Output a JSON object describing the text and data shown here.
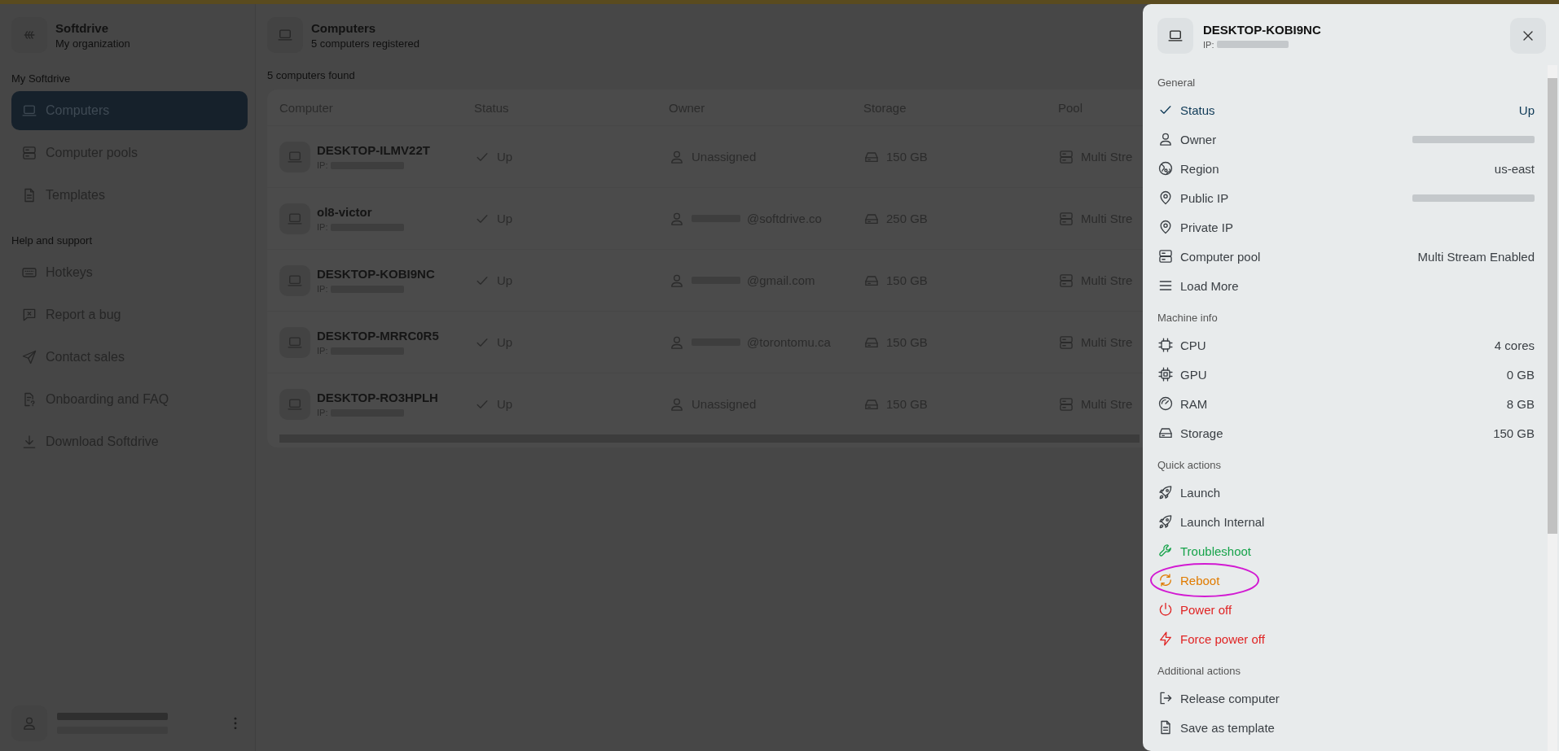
{
  "sidebar": {
    "brand": {
      "name": "Softdrive",
      "subtitle": "My organization"
    },
    "sections": [
      {
        "title": "My Softdrive",
        "items": [
          {
            "label": "Computers",
            "selected": true
          },
          {
            "label": "Computer pools",
            "selected": false
          },
          {
            "label": "Templates",
            "selected": false
          }
        ]
      },
      {
        "title": "Help and support",
        "items": [
          {
            "label": "Hotkeys",
            "selected": false
          },
          {
            "label": "Report a bug",
            "selected": false
          },
          {
            "label": "Contact sales",
            "selected": false
          },
          {
            "label": "Onboarding and FAQ",
            "selected": false
          },
          {
            "label": "Download Softdrive",
            "selected": false
          }
        ]
      }
    ]
  },
  "header": {
    "title": "Computers",
    "subtitle": "5 computers registered"
  },
  "result_count": "5 computers found",
  "table": {
    "columns": [
      "Computer",
      "Status",
      "Owner",
      "Storage",
      "Pool"
    ],
    "rows": [
      {
        "name": "DESKTOP-ILMV22T",
        "ip_label": "IP:",
        "status": "Up",
        "owner": "Unassigned",
        "owner_blurred": false,
        "storage": "150 GB",
        "pool": "Multi Stre"
      },
      {
        "name": "ol8-victor",
        "ip_label": "IP:",
        "status": "Up",
        "owner": "@softdrive.co",
        "owner_blurred": true,
        "storage": "250 GB",
        "pool": "Multi Stre"
      },
      {
        "name": "DESKTOP-KOBI9NC",
        "ip_label": "IP:",
        "status": "Up",
        "owner": "@gmail.com",
        "owner_blurred": true,
        "storage": "150 GB",
        "pool": "Multi Stre"
      },
      {
        "name": "DESKTOP-MRRC0R5",
        "ip_label": "IP:",
        "status": "Up",
        "owner": "@torontomu.ca",
        "owner_blurred": true,
        "storage": "150 GB",
        "pool": "Multi Stre"
      },
      {
        "name": "DESKTOP-RO3HPLH",
        "ip_label": "IP:",
        "status": "Up",
        "owner": "Unassigned",
        "owner_blurred": false,
        "storage": "150 GB",
        "pool": "Multi Stre"
      }
    ]
  },
  "panel": {
    "title": "DESKTOP-KOBI9NC",
    "ip_label": "IP:",
    "sections": [
      {
        "title": "General",
        "rows": [
          {
            "kind": "info",
            "label": "Status",
            "value": "Up",
            "highlight": true,
            "value_blurred": false
          },
          {
            "kind": "info",
            "label": "Owner",
            "value_blurred": true,
            "highlight": false
          },
          {
            "kind": "info",
            "label": "Region",
            "value": "us-east",
            "highlight": false,
            "value_blurred": false
          },
          {
            "kind": "info",
            "label": "Public IP",
            "value_blurred": true,
            "highlight": false
          },
          {
            "kind": "info",
            "label": "Private IP",
            "highlight": false,
            "value_blurred": false
          },
          {
            "kind": "info",
            "label": "Computer pool",
            "value": "Multi Stream Enabled",
            "highlight": false,
            "value_blurred": false
          },
          {
            "kind": "action",
            "label": "Load More",
            "color": "#3a3f44",
            "annotated": false
          }
        ]
      },
      {
        "title": "Machine info",
        "rows": [
          {
            "kind": "info",
            "label": "CPU",
            "value": "4 cores",
            "highlight": false,
            "value_blurred": false
          },
          {
            "kind": "info",
            "label": "GPU",
            "value": "0 GB",
            "highlight": false,
            "value_blurred": false
          },
          {
            "kind": "info",
            "label": "RAM",
            "value": "8 GB",
            "highlight": false,
            "value_blurred": false
          },
          {
            "kind": "info",
            "label": "Storage",
            "value": "150 GB",
            "highlight": false,
            "value_blurred": false
          }
        ]
      },
      {
        "title": "Quick actions",
        "rows": [
          {
            "kind": "action",
            "label": "Launch",
            "color": "#3a3f44",
            "annotated": false
          },
          {
            "kind": "action",
            "label": "Launch Internal",
            "color": "#3a3f44",
            "annotated": false
          },
          {
            "kind": "action",
            "label": "Troubleshoot",
            "color": "#16a34a",
            "annotated": false
          },
          {
            "kind": "action",
            "label": "Reboot",
            "color": "#e07b00",
            "annotated": true
          },
          {
            "kind": "action",
            "label": "Power off",
            "color": "#e02424",
            "annotated": false
          },
          {
            "kind": "action",
            "label": "Force power off",
            "color": "#e02424",
            "annotated": false
          }
        ]
      },
      {
        "title": "Additional actions",
        "rows": [
          {
            "kind": "action",
            "label": "Release computer",
            "color": "#3a3f44",
            "annotated": false
          },
          {
            "kind": "action",
            "label": "Save as template",
            "color": "#3a3f44",
            "annotated": false
          }
        ]
      }
    ]
  }
}
